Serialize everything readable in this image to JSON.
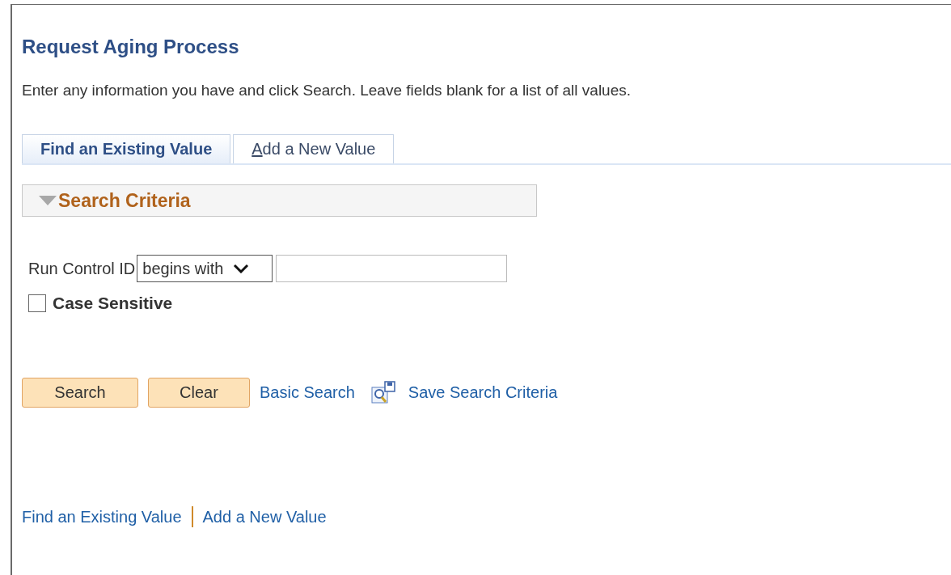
{
  "page_title": "Request Aging Process",
  "instructions": "Enter any information you have and click Search. Leave fields blank for a list of all values.",
  "tabs": [
    {
      "label": "Find an Existing Value",
      "selected": true
    },
    {
      "label": "Add a New Value",
      "selected": false
    }
  ],
  "section": {
    "title": "Search Criteria",
    "expanded": true
  },
  "field": {
    "label": "Run Control ID",
    "operator": "begins with"
  },
  "case_sensitive": {
    "label": "Case Sensitive",
    "checked": false
  },
  "buttons": [
    "Search",
    "Clear"
  ],
  "links": [
    "Basic Search",
    "Save Search Criteria"
  ],
  "footer_links": [
    "Find an Existing Value",
    "Add a New Value"
  ]
}
